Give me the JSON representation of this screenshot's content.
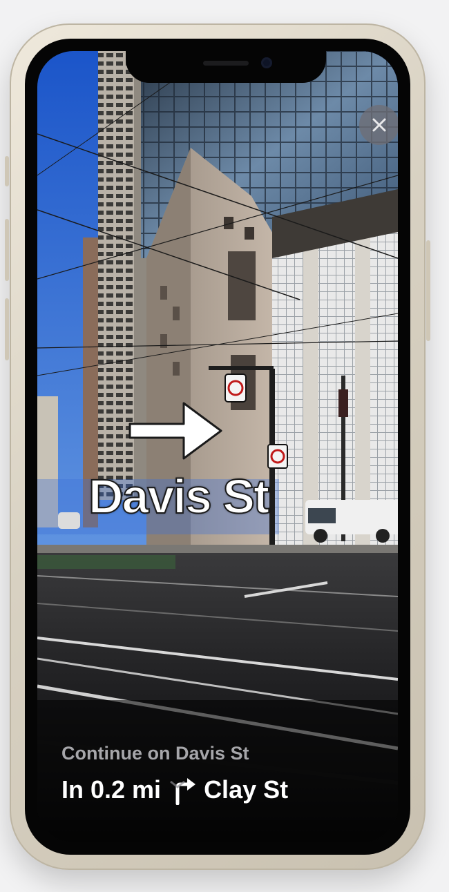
{
  "ar_overlay": {
    "street_label": "Davis St",
    "maneuver": "turn-right-arrow"
  },
  "close_button": {
    "icon": "close-icon"
  },
  "navigation": {
    "current_instruction": "Continue on Davis St",
    "next_distance": "In 0.2 mi",
    "next_turn_icon": "turn-right-icon",
    "next_street": "Clay St"
  },
  "colors": {
    "label_text": "#ffffff",
    "secondary_text": "#a6a6aa",
    "close_button_bg": "#6e6e76"
  }
}
